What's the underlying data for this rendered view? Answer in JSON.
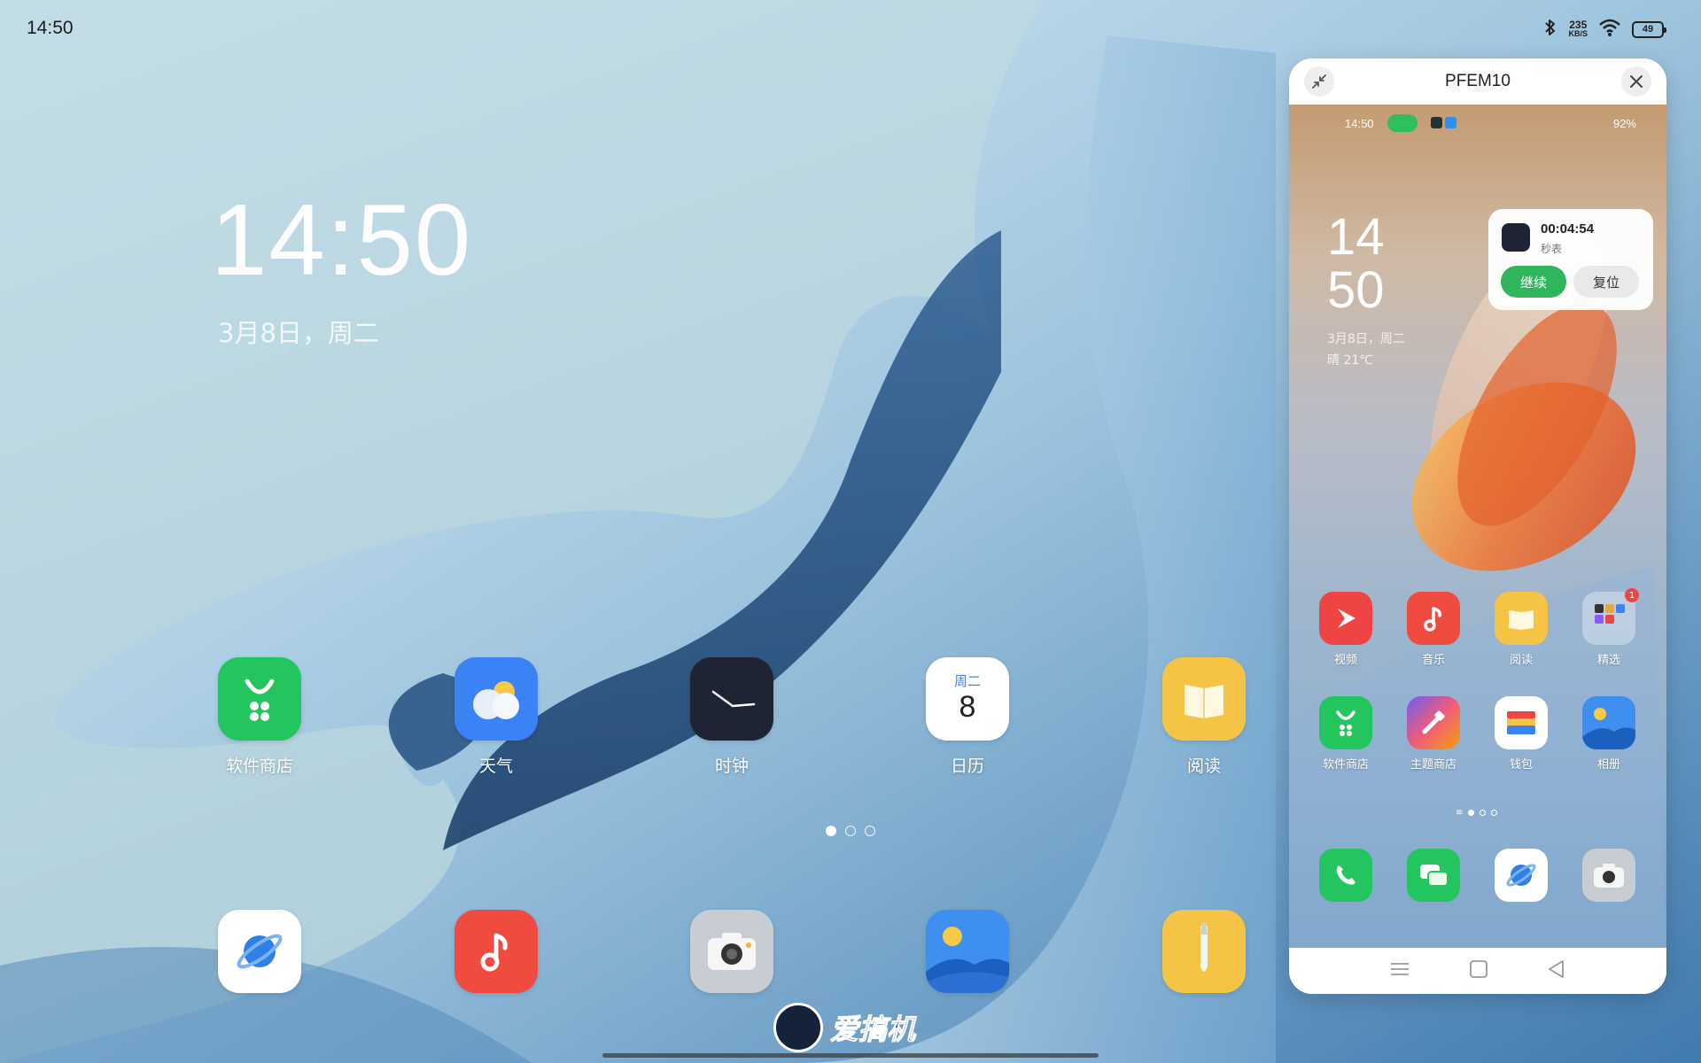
{
  "status_bar": {
    "time": "14:50",
    "bluetooth_icon": "bluetooth-icon",
    "net_speed_value": "235",
    "net_speed_unit": "KB/S",
    "wifi_icon": "wifi-icon",
    "battery": "49"
  },
  "clock_widget": {
    "time": "14:50",
    "date": "3月8日，周二"
  },
  "apps": [
    {
      "label": "软件商店",
      "icon": "app-store-icon"
    },
    {
      "label": "天气",
      "icon": "weather-icon"
    },
    {
      "label": "时钟",
      "icon": "clock-icon"
    },
    {
      "label": "日历",
      "icon": "calendar-icon",
      "calendar_weekday": "周二",
      "calendar_day": "8"
    },
    {
      "label": "阅读",
      "icon": "book-icon"
    }
  ],
  "dock": [
    {
      "icon": "browser-icon"
    },
    {
      "icon": "music-icon"
    },
    {
      "icon": "camera-icon"
    },
    {
      "icon": "gallery-icon"
    },
    {
      "icon": "notes-icon"
    }
  ],
  "page_indicator": {
    "count": 3,
    "active": 0
  },
  "watermark": {
    "text": "爱搞机"
  },
  "phone_window": {
    "title": "PFEM10",
    "screen": {
      "status_time": "14:50",
      "battery": "92%",
      "clock_hour": "14",
      "clock_minute": "50",
      "date": "3月8日，周二",
      "weather": "晴  21℃",
      "stopwatch": {
        "time": "00:04:54",
        "label": "秒表",
        "continue_label": "继续",
        "reset_label": "复位"
      },
      "apps_row1": [
        {
          "label": "视频",
          "icon": "video-icon"
        },
        {
          "label": "音乐",
          "icon": "music-icon"
        },
        {
          "label": "阅读",
          "icon": "book-icon"
        },
        {
          "label": "精选",
          "icon": "folder-icon",
          "badge": "1"
        }
      ],
      "apps_row2": [
        {
          "label": "软件商店",
          "icon": "app-store-icon"
        },
        {
          "label": "主题商店",
          "icon": "theme-store-icon"
        },
        {
          "label": "钱包",
          "icon": "wallet-icon"
        },
        {
          "label": "相册",
          "icon": "gallery-icon"
        }
      ],
      "dock": [
        {
          "icon": "phone-icon"
        },
        {
          "icon": "messages-icon"
        },
        {
          "icon": "browser-icon"
        },
        {
          "icon": "camera-icon"
        }
      ]
    },
    "navbar": [
      "menu-icon",
      "home-icon",
      "back-icon"
    ]
  },
  "colors": {
    "app_store_green": "#22c55e",
    "weather_blue": "#3b82f6",
    "clock_dark": "#1e2433",
    "reading_yellow": "#f5c445",
    "music_red": "#ef4b3f",
    "stopwatch_green": "#2fb55b"
  }
}
